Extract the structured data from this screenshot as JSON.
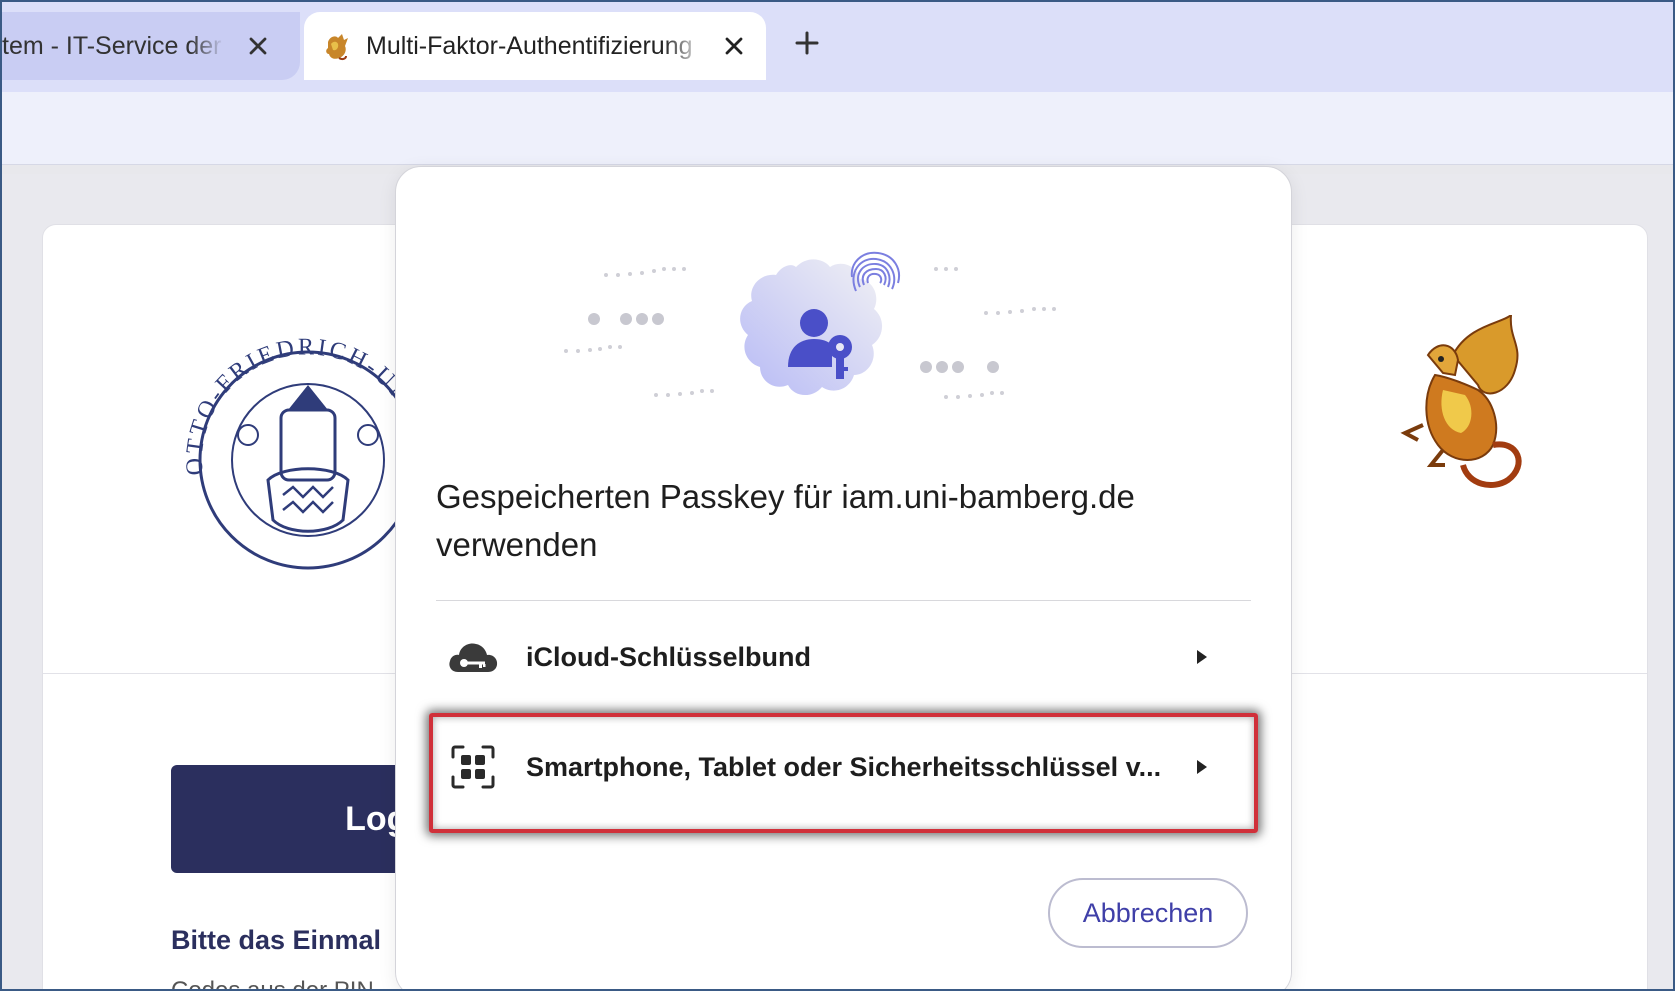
{
  "browser": {
    "tabs": [
      {
        "title": "tem - IT-Service der",
        "active": false
      },
      {
        "title": "Multi-Faktor-Authentifizierung",
        "active": true
      }
    ],
    "new_tab_icon": "plus-icon"
  },
  "page": {
    "login_button": "Logi",
    "info_heading": "Bitte das Einmal",
    "info_line": "Codes aus der PIN"
  },
  "dialog": {
    "title": "Gespeicherten Passkey für iam.uni-bamberg.de verwenden",
    "options": [
      {
        "label": "iCloud-Schlüsselbund",
        "icon": "cloud-key-icon"
      },
      {
        "label": "Smartphone, Tablet oder Sicherheitsschlüssel v...",
        "icon": "qr-code-icon"
      }
    ],
    "cancel_label": "Abbrechen"
  },
  "colors": {
    "accent": "#3f3fa8",
    "highlight": "#d0303a",
    "login": "#2b2f5e",
    "tabstrip": "#dcdff9"
  }
}
